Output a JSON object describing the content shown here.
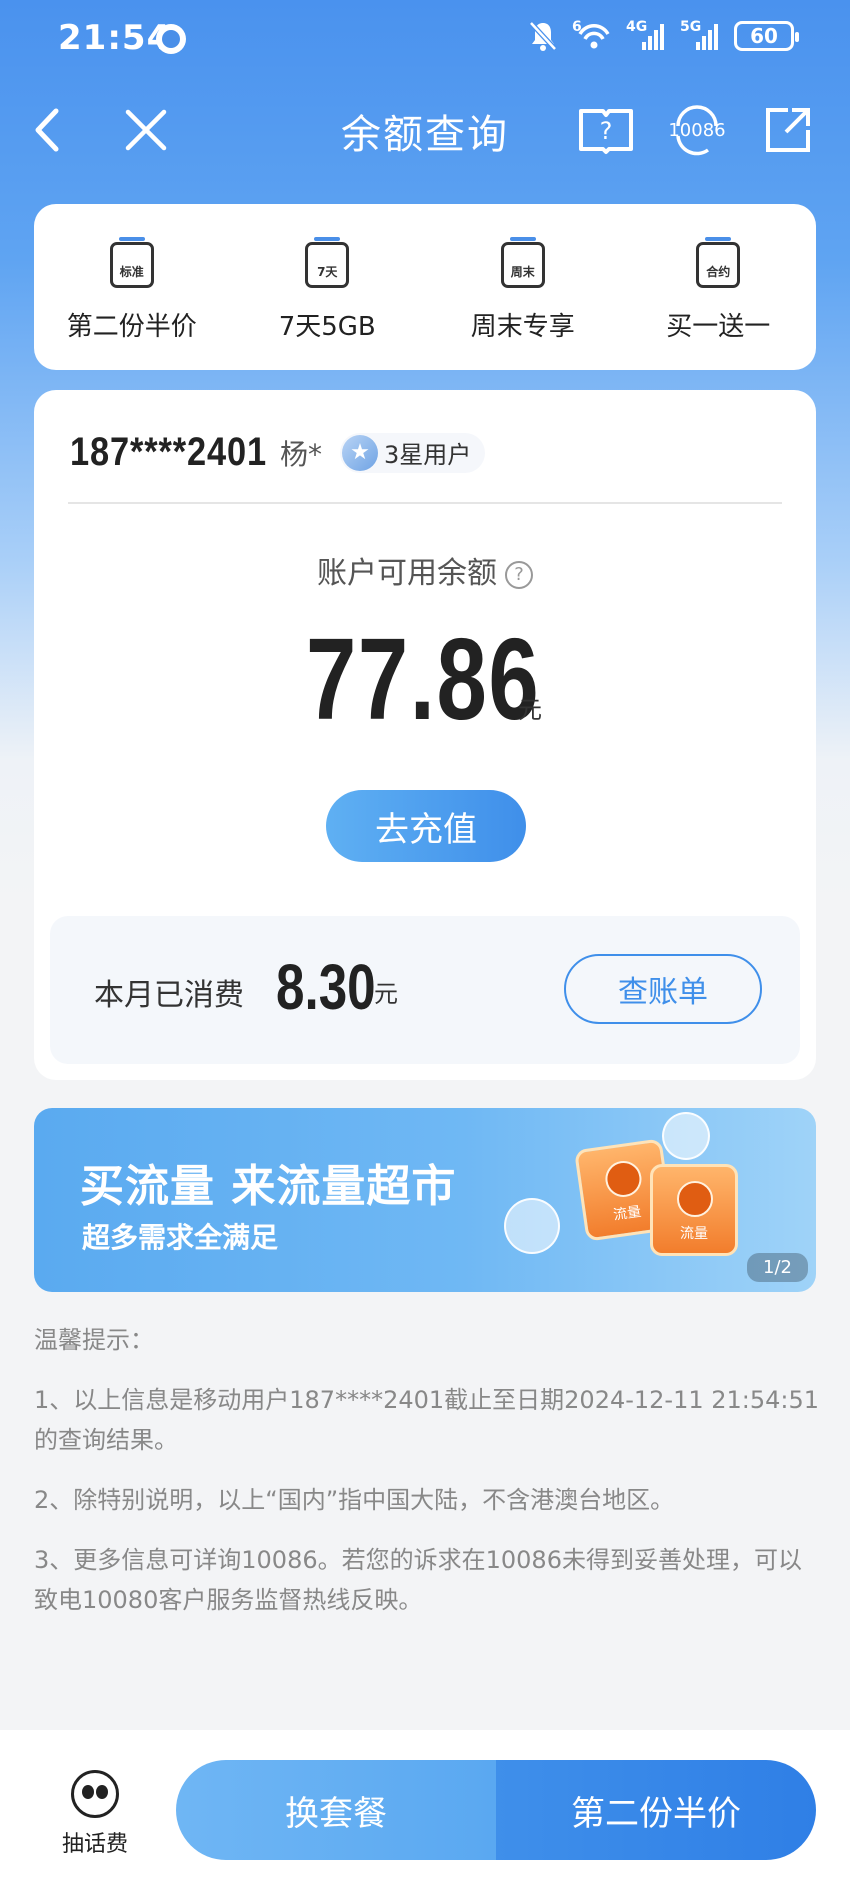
{
  "status_bar": {
    "time": "21:54",
    "battery": "60",
    "signal_1": "4G",
    "signal_2": "5G",
    "wifi": "6"
  },
  "nav": {
    "title": "余额查询",
    "service_label": "10086"
  },
  "quick_actions": [
    {
      "icon_text": "标准",
      "label": "第二份半价"
    },
    {
      "icon_text": "7天",
      "label": "7天5GB"
    },
    {
      "icon_text": "周末",
      "label": "周末专享"
    },
    {
      "icon_text": "合约",
      "label": "买一送一"
    }
  ],
  "account": {
    "phone": "187****2401",
    "name": "杨*",
    "level": "3星用户",
    "balance_label": "账户可用余额",
    "balance": "77.86",
    "balance_unit": "元",
    "recharge_label": "去充值",
    "consumed_label": "本月已消费",
    "consumed": "8.30",
    "consumed_unit": "元",
    "bill_label": "查账单"
  },
  "banner": {
    "title": "买流量 来流量超市",
    "subtitle": "超多需求全满足",
    "bag_label": "流量",
    "page_indicator": "1/2"
  },
  "tips": {
    "heading": "温馨提示：",
    "items": [
      "1、以上信息是移动用户187****2401截止至日期2024-12-11 21:54:51的查询结果。",
      "2、除特别说明，以上“国内”指中国大陆，不含港澳台地区。",
      "3、更多信息可详询10086。若您的诉求在10086未得到妥善处理，可以致电10080客户服务监督热线反映。"
    ]
  },
  "bottom": {
    "lottery_label": "抽话费",
    "change_plan": "换套餐",
    "half_price": "第二份半价"
  },
  "colors": {
    "brand_blue": "#3f8fea",
    "header_blue": "#4a92ee"
  },
  "icons": [
    "back-icon",
    "close-icon",
    "help-book-icon",
    "customer-service-icon",
    "share-icon",
    "star-icon",
    "question-icon",
    "panda-icon"
  ]
}
